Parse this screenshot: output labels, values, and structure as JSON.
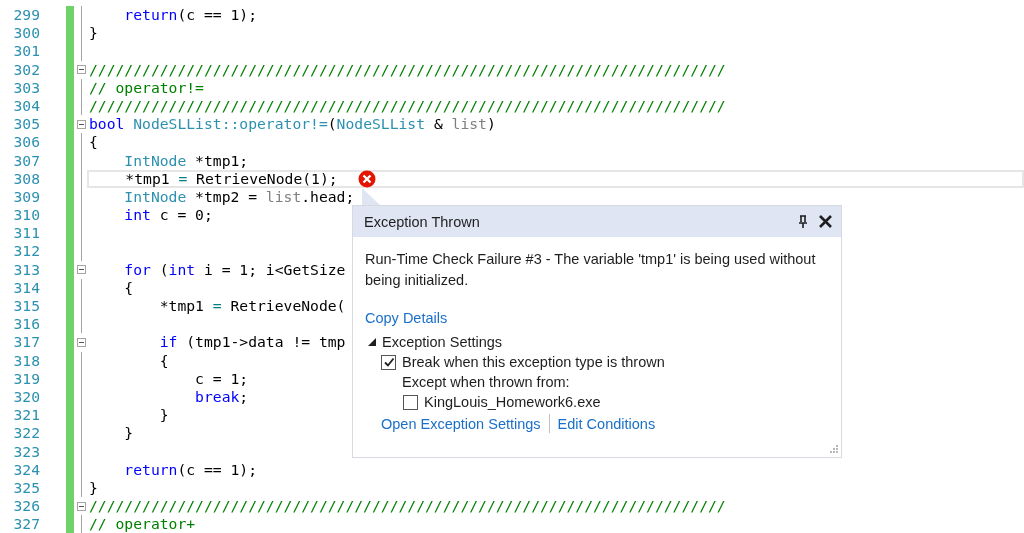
{
  "editor": {
    "lines": [
      {
        "number": "299",
        "foldable": false,
        "current": false,
        "error": false,
        "tokens": [
          {
            "kind": "kw",
            "text": "    return"
          },
          {
            "kind": "plain",
            "text": "(c == 1);"
          }
        ]
      },
      {
        "number": "300",
        "foldable": false,
        "current": false,
        "error": false,
        "tokens": [
          {
            "kind": "plain",
            "text": "}"
          }
        ]
      },
      {
        "number": "301",
        "foldable": false,
        "current": false,
        "error": false
      },
      {
        "number": "302",
        "foldable": true,
        "current": false,
        "error": false,
        "tokens": [
          {
            "kind": "cmt",
            "text": "////////////////////////////////////////////////////////////////////////"
          }
        ]
      },
      {
        "number": "303",
        "foldable": false,
        "current": false,
        "error": false,
        "tokens": [
          {
            "kind": "cmt",
            "text": "// operator!="
          }
        ]
      },
      {
        "number": "304",
        "foldable": false,
        "current": false,
        "error": false,
        "tokens": [
          {
            "kind": "cmt",
            "text": "////////////////////////////////////////////////////////////////////////"
          }
        ]
      },
      {
        "number": "305",
        "foldable": true,
        "current": false,
        "error": false,
        "tokens": [
          {
            "kind": "kw",
            "text": "bool"
          },
          {
            "kind": "type",
            "text": " NodeSLList::operator!="
          },
          {
            "kind": "plain",
            "text": "("
          },
          {
            "kind": "type",
            "text": "NodeSLList"
          },
          {
            "kind": "plain",
            "text": " &"
          },
          {
            "kind": "param",
            "text": " list"
          },
          {
            "kind": "plain",
            "text": ")"
          }
        ]
      },
      {
        "number": "306",
        "foldable": false,
        "current": false,
        "error": false,
        "tokens": [
          {
            "kind": "plain",
            "text": "{"
          }
        ]
      },
      {
        "number": "307",
        "foldable": false,
        "current": false,
        "error": false,
        "tokens": [
          {
            "kind": "type",
            "text": "    IntNode"
          },
          {
            "kind": "plain",
            "text": " *tmp1;"
          }
        ]
      },
      {
        "number": "308",
        "foldable": false,
        "current": true,
        "error": true,
        "tokens": [
          {
            "kind": "plain",
            "text": "    *tmp1"
          },
          {
            "kind": "op",
            "text": " ="
          },
          {
            "kind": "plain",
            "text": " RetrieveNode(1);"
          }
        ]
      },
      {
        "number": "309",
        "foldable": false,
        "current": false,
        "error": false,
        "tokens": [
          {
            "kind": "type",
            "text": "    IntNode"
          },
          {
            "kind": "plain",
            "text": " *tmp2 ="
          },
          {
            "kind": "param",
            "text": " list"
          },
          {
            "kind": "plain",
            "text": ".head;"
          }
        ]
      },
      {
        "number": "310",
        "foldable": false,
        "current": false,
        "error": false,
        "tokens": [
          {
            "kind": "kw",
            "text": "    int"
          },
          {
            "kind": "plain",
            "text": " c = 0;"
          }
        ]
      },
      {
        "number": "311",
        "foldable": false,
        "current": false,
        "error": false
      },
      {
        "number": "312",
        "foldable": false,
        "current": false,
        "error": false
      },
      {
        "number": "313",
        "foldable": true,
        "current": false,
        "error": false,
        "tokens": [
          {
            "kind": "kw",
            "text": "    for"
          },
          {
            "kind": "plain",
            "text": " ("
          },
          {
            "kind": "kw",
            "text": "int"
          },
          {
            "kind": "plain",
            "text": " i = 1; i<GetSize"
          }
        ]
      },
      {
        "number": "314",
        "foldable": false,
        "current": false,
        "error": false,
        "tokens": [
          {
            "kind": "plain",
            "text": "    {"
          }
        ]
      },
      {
        "number": "315",
        "foldable": false,
        "current": false,
        "error": false,
        "tokens": [
          {
            "kind": "plain",
            "text": "        *tmp1"
          },
          {
            "kind": "op",
            "text": " ="
          },
          {
            "kind": "plain",
            "text": " RetrieveNode("
          }
        ]
      },
      {
        "number": "316",
        "foldable": false,
        "current": false,
        "error": false
      },
      {
        "number": "317",
        "foldable": true,
        "current": false,
        "error": false,
        "tokens": [
          {
            "kind": "kw",
            "text": "        if"
          },
          {
            "kind": "plain",
            "text": " (tmp1->data != tmp"
          }
        ]
      },
      {
        "number": "318",
        "foldable": false,
        "current": false,
        "error": false,
        "tokens": [
          {
            "kind": "plain",
            "text": "        {"
          }
        ]
      },
      {
        "number": "319",
        "foldable": false,
        "current": false,
        "error": false,
        "tokens": [
          {
            "kind": "plain",
            "text": "            c = 1;"
          }
        ]
      },
      {
        "number": "320",
        "foldable": false,
        "current": false,
        "error": false,
        "tokens": [
          {
            "kind": "kw",
            "text": "            break"
          },
          {
            "kind": "plain",
            "text": ";"
          }
        ]
      },
      {
        "number": "321",
        "foldable": false,
        "current": false,
        "error": false,
        "tokens": [
          {
            "kind": "plain",
            "text": "        }"
          }
        ]
      },
      {
        "number": "322",
        "foldable": false,
        "current": false,
        "error": false,
        "tokens": [
          {
            "kind": "plain",
            "text": "    }"
          }
        ]
      },
      {
        "number": "323",
        "foldable": false,
        "current": false,
        "error": false
      },
      {
        "number": "324",
        "foldable": false,
        "current": false,
        "error": false,
        "tokens": [
          {
            "kind": "kw",
            "text": "    return"
          },
          {
            "kind": "plain",
            "text": "(c == 1);"
          }
        ]
      },
      {
        "number": "325",
        "foldable": false,
        "current": false,
        "error": false,
        "tokens": [
          {
            "kind": "plain",
            "text": "}"
          }
        ]
      },
      {
        "number": "326",
        "foldable": true,
        "current": false,
        "error": false,
        "tokens": [
          {
            "kind": "cmt",
            "text": "////////////////////////////////////////////////////////////////////////"
          }
        ]
      },
      {
        "number": "327",
        "foldable": false,
        "current": false,
        "error": false,
        "tokens": [
          {
            "kind": "cmt",
            "text": "// operator+"
          }
        ]
      }
    ]
  },
  "exception_popup": {
    "title": "Exception Thrown",
    "message": "Run-Time Check Failure #3 - The variable 'tmp1' is being used without being initialized.",
    "copy_link": "Copy Details",
    "settings": {
      "label": "Exception Settings",
      "expanded": true,
      "break_option": {
        "label": "Break when this exception type is thrown",
        "checked": true
      },
      "except_label": "Except when thrown from:",
      "modules": [
        {
          "label": "KingLouis_Homework6.exe",
          "checked": false
        }
      ]
    },
    "links": [
      "Open Exception Settings",
      "Edit Conditions"
    ]
  }
}
